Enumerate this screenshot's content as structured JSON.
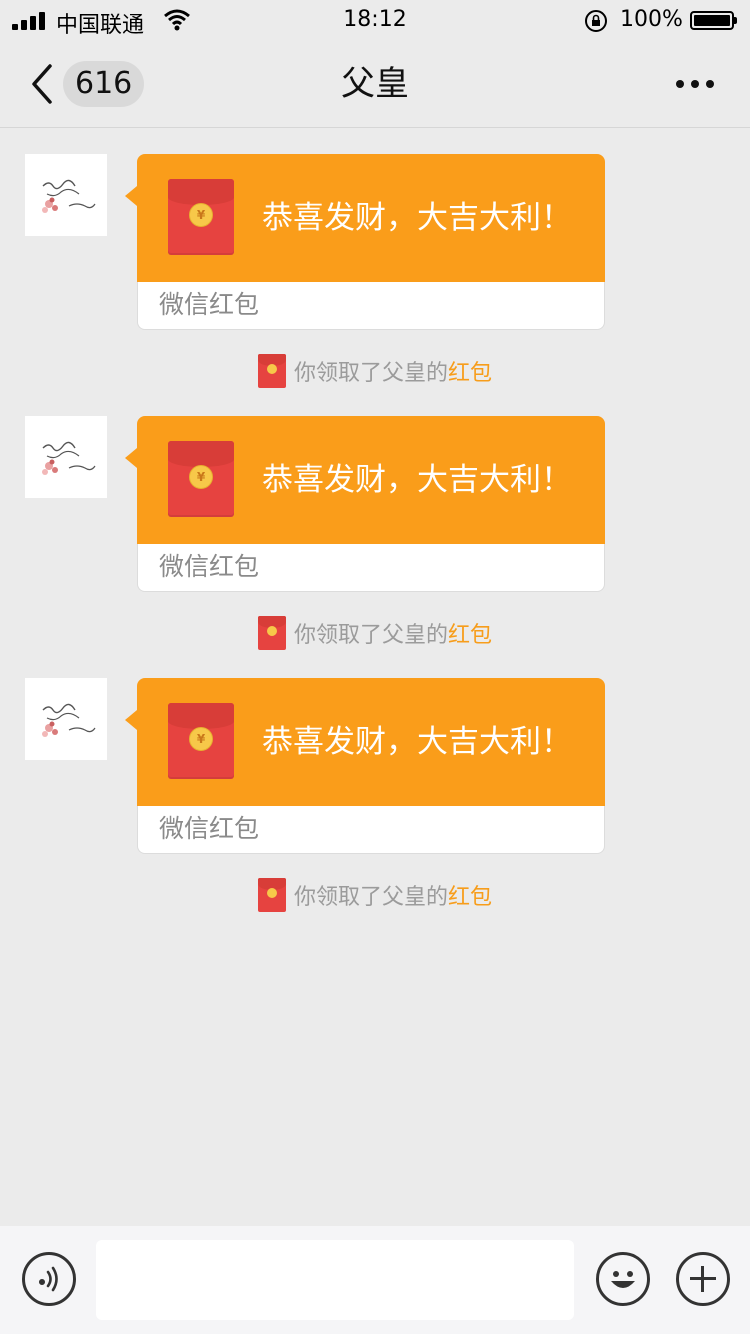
{
  "status_bar": {
    "carrier": "中国联通",
    "time": "18:12",
    "battery": "100%",
    "battery_level": 1.0
  },
  "nav": {
    "back_icon": "chevron-left-icon",
    "unread_count": "616",
    "title": "父皇",
    "more_icon": "more-icon"
  },
  "messages": [
    {
      "greeting": "恭喜发财，大吉大利！",
      "label": "微信红包",
      "notice_prefix": "你领取了父皇的",
      "notice_link": "红包"
    },
    {
      "greeting": "恭喜发财，大吉大利！",
      "label": "微信红包",
      "notice_prefix": "你领取了父皇的",
      "notice_link": "红包"
    },
    {
      "greeting": "恭喜发财，大吉大利！",
      "label": "微信红包",
      "notice_prefix": "你领取了父皇的",
      "notice_link": "红包"
    }
  ],
  "input_bar": {
    "voice_icon": "voice-icon",
    "emoji_icon": "emoji-icon",
    "plus_icon": "plus-icon"
  },
  "colors": {
    "packet": "#fa9d1a",
    "envelope": "#e64340",
    "link": "#f79d1b"
  }
}
